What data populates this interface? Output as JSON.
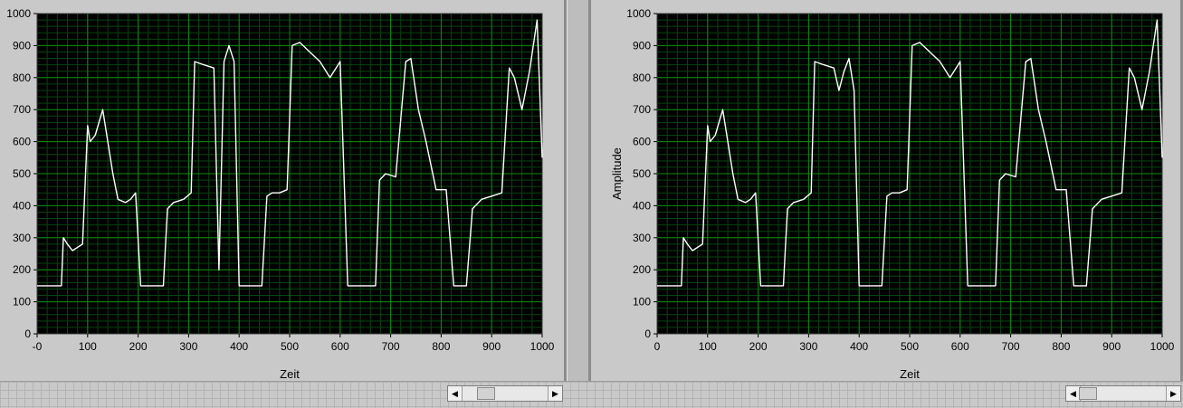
{
  "colors": {
    "plot_bg": "#000000",
    "major_grid": "#0a8c0a",
    "minor_grid": "#05450f",
    "trace": "#ffffff",
    "panel_bg": "#c9c9c9"
  },
  "chart_data": [
    {
      "type": "line",
      "xlabel": "Zeit",
      "ylabel": "",
      "xlim": [
        0,
        1000
      ],
      "ylim": [
        0,
        1000
      ],
      "x_tick_labels": [
        "-0",
        "100",
        "200",
        "300",
        "400",
        "500",
        "600",
        "700",
        "800",
        "900",
        "1000"
      ],
      "y_tick_labels": [
        "0",
        "100",
        "200",
        "300",
        "400",
        "500",
        "600",
        "700",
        "800",
        "900",
        "1000"
      ],
      "grid": true,
      "series": [
        {
          "x": [
            0,
            48,
            52,
            60,
            70,
            80,
            90,
            100,
            105,
            115,
            130,
            140,
            150,
            160,
            175,
            185,
            195,
            205,
            220,
            250,
            258,
            270,
            290,
            305,
            312,
            330,
            350,
            360,
            370,
            380,
            390,
            400,
            410,
            420,
            445,
            455,
            465,
            480,
            495,
            505,
            520,
            540,
            560,
            580,
            600,
            615,
            630,
            650,
            670,
            678,
            690,
            710,
            730,
            740,
            755,
            770,
            790,
            810,
            825,
            835,
            850,
            862,
            880,
            900,
            920,
            935,
            945,
            960,
            975,
            990,
            1000
          ],
          "y": [
            150,
            150,
            300,
            280,
            260,
            270,
            280,
            650,
            600,
            620,
            700,
            600,
            500,
            420,
            410,
            420,
            440,
            150,
            150,
            150,
            390,
            410,
            420,
            440,
            850,
            840,
            830,
            200,
            850,
            900,
            850,
            150,
            150,
            150,
            150,
            430,
            440,
            440,
            450,
            900,
            910,
            880,
            850,
            800,
            850,
            150,
            150,
            150,
            150,
            480,
            500,
            490,
            850,
            860,
            700,
            600,
            450,
            450,
            150,
            150,
            150,
            390,
            420,
            430,
            440,
            830,
            800,
            700,
            820,
            980,
            550
          ]
        }
      ]
    },
    {
      "type": "line",
      "xlabel": "Zeit",
      "ylabel": "Amplitude",
      "xlim": [
        0,
        1000
      ],
      "ylim": [
        0,
        1000
      ],
      "x_tick_labels": [
        "0",
        "100",
        "200",
        "300",
        "400",
        "500",
        "600",
        "700",
        "800",
        "900",
        "1000"
      ],
      "y_tick_labels": [
        "0",
        "100",
        "200",
        "300",
        "400",
        "500",
        "600",
        "700",
        "800",
        "900",
        "1000"
      ],
      "grid": true,
      "series": [
        {
          "x": [
            0,
            48,
            52,
            60,
            70,
            80,
            90,
            100,
            105,
            115,
            130,
            140,
            150,
            160,
            175,
            185,
            195,
            205,
            220,
            250,
            258,
            270,
            290,
            305,
            312,
            330,
            350,
            360,
            370,
            380,
            390,
            400,
            410,
            420,
            445,
            455,
            465,
            480,
            495,
            505,
            520,
            540,
            560,
            580,
            600,
            615,
            630,
            650,
            670,
            678,
            690,
            710,
            730,
            740,
            755,
            770,
            790,
            810,
            825,
            835,
            850,
            862,
            880,
            900,
            920,
            935,
            945,
            960,
            975,
            990,
            1000
          ],
          "y": [
            150,
            150,
            300,
            280,
            260,
            270,
            280,
            650,
            600,
            620,
            700,
            600,
            500,
            420,
            410,
            420,
            440,
            150,
            150,
            150,
            390,
            410,
            420,
            440,
            850,
            840,
            830,
            760,
            820,
            860,
            760,
            150,
            150,
            150,
            150,
            430,
            440,
            440,
            450,
            900,
            910,
            880,
            850,
            800,
            850,
            150,
            150,
            150,
            150,
            480,
            500,
            490,
            850,
            860,
            700,
            600,
            450,
            450,
            150,
            150,
            150,
            390,
            420,
            430,
            440,
            830,
            800,
            700,
            820,
            980,
            550
          ]
        }
      ]
    }
  ]
}
